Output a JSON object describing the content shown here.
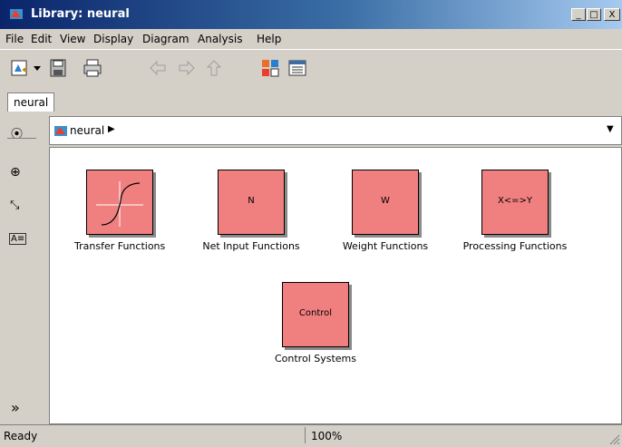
{
  "window": {
    "title": "Library: neural",
    "minimize_glyph": "_",
    "maximize_glyph": "□",
    "close_glyph": "X"
  },
  "menu": [
    "File",
    "Edit",
    "View",
    "Display",
    "Diagram",
    "Analysis",
    "Help"
  ],
  "toolbar": {
    "icons": [
      "new-library-icon",
      "dropdown-arrow-icon",
      "save-icon",
      "print-icon",
      "back-icon",
      "forward-icon",
      "up-icon",
      "library-browser-icon",
      "model-explorer-icon"
    ]
  },
  "tabs": [
    {
      "label": "neural"
    }
  ],
  "address": {
    "path": "neural",
    "separator_glyph": "▶",
    "dropdown_glyph": "▼"
  },
  "left_tools": [
    "navigate-icon",
    "zoom-icon",
    "fit-view-icon",
    "annotation-icon"
  ],
  "left_tools_glyphs": {
    "navigate": "⦿",
    "zoom": "⊕",
    "fit": "⤡",
    "annotation": "A≡",
    "expand": "»",
    "lock": "🔓"
  },
  "blocks": [
    {
      "id": "transfer",
      "inner": "",
      "label": "Transfer Functions"
    },
    {
      "id": "netinput",
      "inner": "N",
      "label": "Net Input Functions"
    },
    {
      "id": "weight",
      "inner": "W",
      "label": "Weight Functions"
    },
    {
      "id": "processing",
      "inner": "X<=>Y",
      "label": "Processing Functions"
    },
    {
      "id": "control",
      "inner": "Control",
      "label": "Control Systems"
    }
  ],
  "status": {
    "text": "Ready",
    "zoom": "100%"
  },
  "colors": {
    "block_fill": "#f08080",
    "title_gradient_start": "#0a246a"
  }
}
